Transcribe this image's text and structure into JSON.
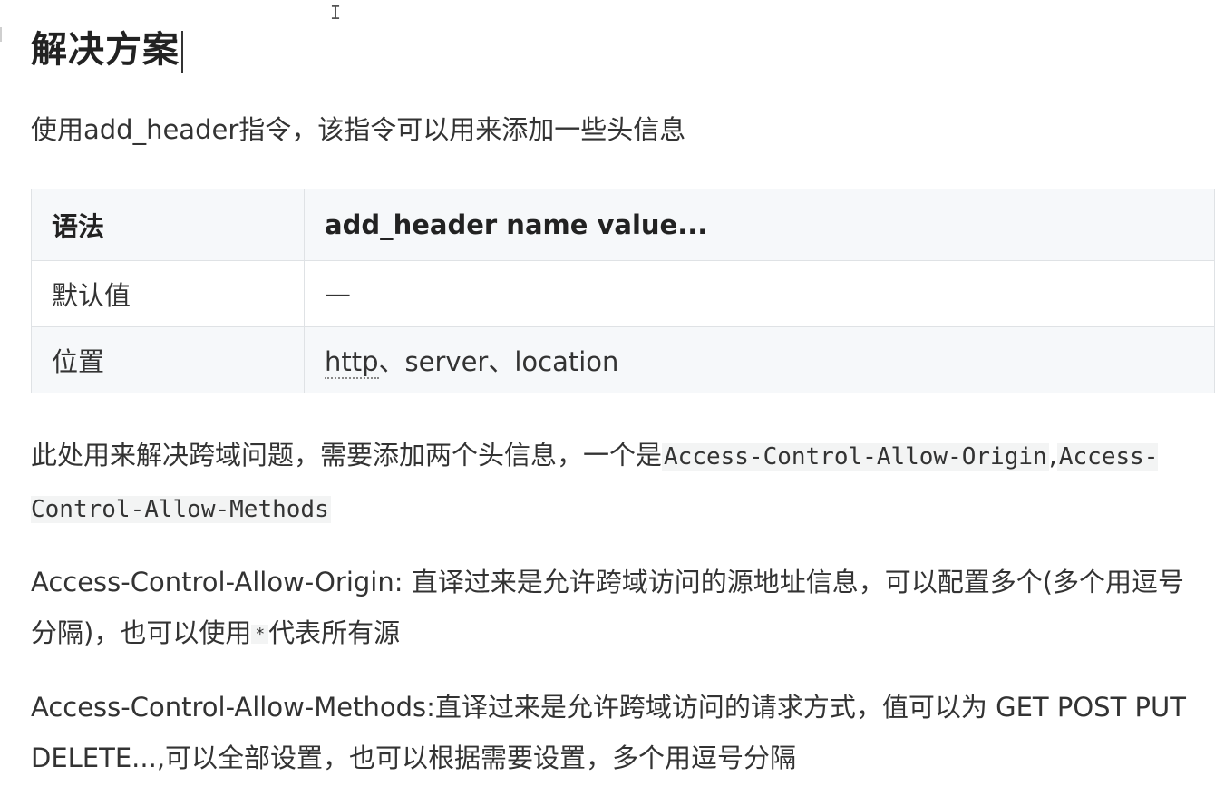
{
  "heading": "解决方案",
  "intro": "使用add_header指令，该指令可以用来添加一些头信息",
  "table": {
    "header": {
      "key": "语法",
      "value": "add_header name  value..."
    },
    "rows": [
      {
        "key": "默认值",
        "value": "—"
      },
      {
        "key": "位置",
        "value_link": "http",
        "value_rest": "、server、location"
      }
    ]
  },
  "para1": {
    "text": "此处用来解决跨域问题，需要添加两个头信息，一个是",
    "code1": "Access-Control-Allow-Origin",
    "sep": ",",
    "code2": "Access-Control-Allow-Methods"
  },
  "para2": {
    "text_before": "Access-Control-Allow-Origin: 直译过来是允许跨域访问的源地址信息，可以配置多个(多个用逗号分隔)，也可以使用",
    "code": "*",
    "text_after": "代表所有源"
  },
  "para3": {
    "text": "Access-Control-Allow-Methods:直译过来是允许跨域访问的请求方式，值可以为 GET POST PUT DELETE...,可以全部设置，也可以根据需要设置，多个用逗号分隔"
  },
  "cursor_glyph": "I"
}
